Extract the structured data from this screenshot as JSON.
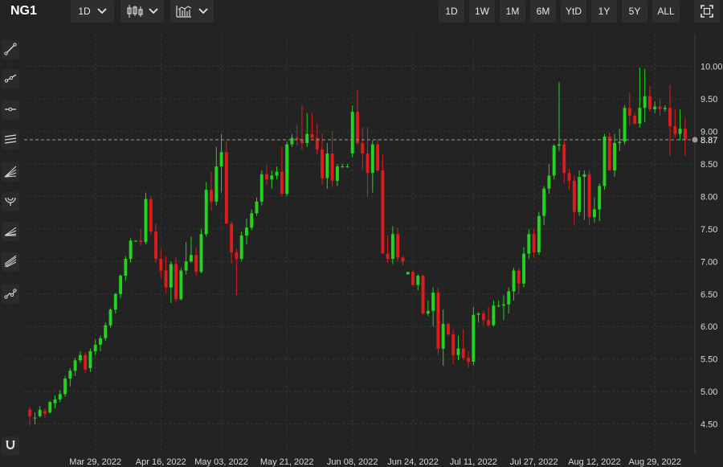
{
  "toolbar": {
    "symbol": "NG1",
    "interval": "1D",
    "chart_type_icon": "candlestick-icon",
    "indicator_icon": "indicators-icon",
    "ranges": [
      "1D",
      "1W",
      "1M",
      "6M",
      "YtD",
      "1Y",
      "5Y",
      "ALL"
    ],
    "fullscreen_icon": "fullscreen-icon"
  },
  "sidebar": {
    "tools": [
      "trendline-icon",
      "ray-icon",
      "horizontal-line-icon",
      "parallel-channel-icon",
      "fib-fan-icon",
      "arc-icon",
      "pitchfork-icon",
      "gann-icon",
      "path-icon"
    ],
    "bottom_tool": "magnet-icon"
  },
  "colors": {
    "up": "#22d41f",
    "down": "#e01b1b",
    "background": "#232323",
    "grid": "#363636",
    "axis_text": "#d8d8d8"
  },
  "chart_data": {
    "type": "candlestick",
    "ylim": [
      4.1,
      10.5
    ],
    "y_ticks": [
      "10.00",
      "9.50",
      "9.00",
      "8.50",
      "8.00",
      "7.50",
      "7.00",
      "6.50",
      "6.00",
      "5.50",
      "5.00",
      "4.50"
    ],
    "current_price": "8.87",
    "x_ticks": [
      "Mar 29, 2022",
      "Apr 16, 2022",
      "May 03, 2022",
      "May 21, 2022",
      "Jun 08, 2022",
      "Jun 24, 2022",
      "Jul 11, 2022",
      "Jul 27, 2022",
      "Aug 12, 2022",
      "Aug 29, 2022"
    ],
    "x_tick_index": [
      13,
      26,
      38,
      51,
      64,
      76,
      88,
      100,
      112,
      124
    ],
    "grid": true,
    "candles": [
      [
        4.72,
        4.76,
        4.48,
        4.62
      ],
      [
        4.6,
        4.68,
        4.5,
        4.6
      ],
      [
        4.62,
        4.78,
        4.6,
        4.72
      ],
      [
        4.7,
        4.74,
        4.6,
        4.66
      ],
      [
        4.68,
        4.86,
        4.66,
        4.84
      ],
      [
        4.82,
        4.94,
        4.74,
        4.88
      ],
      [
        4.88,
        5.02,
        4.84,
        4.96
      ],
      [
        4.96,
        5.24,
        4.92,
        5.2
      ],
      [
        5.2,
        5.36,
        5.08,
        5.32
      ],
      [
        5.32,
        5.52,
        5.24,
        5.48
      ],
      [
        5.48,
        5.62,
        5.44,
        5.56
      ],
      [
        5.56,
        5.6,
        5.28,
        5.34
      ],
      [
        5.36,
        5.66,
        5.3,
        5.62
      ],
      [
        5.62,
        5.8,
        5.56,
        5.72
      ],
      [
        5.72,
        5.86,
        5.62,
        5.82
      ],
      [
        5.82,
        6.06,
        5.78,
        6.02
      ],
      [
        6.02,
        6.28,
        5.98,
        6.26
      ],
      [
        6.26,
        6.52,
        6.2,
        6.5
      ],
      [
        6.5,
        6.8,
        6.44,
        6.78
      ],
      [
        6.78,
        7.08,
        6.7,
        7.04
      ],
      [
        7.04,
        7.36,
        6.98,
        7.32
      ],
      [
        7.32,
        7.32,
        7.3,
        7.32
      ],
      [
        7.32,
        7.5,
        7.24,
        7.3
      ],
      [
        7.3,
        8.06,
        7.26,
        7.96
      ],
      [
        7.96,
        8.0,
        7.4,
        7.46
      ],
      [
        7.46,
        7.58,
        6.98,
        7.04
      ],
      [
        7.04,
        7.2,
        6.74,
        6.86
      ],
      [
        6.86,
        7.08,
        6.52,
        6.6
      ],
      [
        6.6,
        7.0,
        6.36,
        6.96
      ],
      [
        6.96,
        7.06,
        6.38,
        6.42
      ],
      [
        6.42,
        6.9,
        6.4,
        6.86
      ],
      [
        6.86,
        7.3,
        6.8,
        7.0
      ],
      [
        7.0,
        7.38,
        6.98,
        7.1
      ],
      [
        7.1,
        7.22,
        6.78,
        6.84
      ],
      [
        6.84,
        7.5,
        6.82,
        7.42
      ],
      [
        7.42,
        8.22,
        7.38,
        8.1
      ],
      [
        8.1,
        8.38,
        7.78,
        7.92
      ],
      [
        7.92,
        8.76,
        7.86,
        8.46
      ],
      [
        8.46,
        8.96,
        8.06,
        8.68
      ],
      [
        8.68,
        8.84,
        7.62,
        7.58
      ],
      [
        7.58,
        7.62,
        6.96,
        7.14
      ],
      [
        7.14,
        7.2,
        6.48,
        7.04
      ],
      [
        7.04,
        7.46,
        7.0,
        7.4
      ],
      [
        7.4,
        7.66,
        7.26,
        7.52
      ],
      [
        7.52,
        7.8,
        7.48,
        7.74
      ],
      [
        7.74,
        7.98,
        7.7,
        7.92
      ],
      [
        7.92,
        8.4,
        7.86,
        8.34
      ],
      [
        8.34,
        8.48,
        8.18,
        8.26
      ],
      [
        8.26,
        8.4,
        8.12,
        8.32
      ],
      [
        8.32,
        8.46,
        8.26,
        8.38
      ],
      [
        8.38,
        8.76,
        8.0,
        8.04
      ],
      [
        8.04,
        8.84,
        8.0,
        8.8
      ],
      [
        8.8,
        8.96,
        8.76,
        8.9
      ],
      [
        8.9,
        9.1,
        8.78,
        8.88
      ],
      [
        8.88,
        9.4,
        8.72,
        8.82
      ],
      [
        8.82,
        9.28,
        8.76,
        8.96
      ],
      [
        8.96,
        9.28,
        8.86,
        8.9
      ],
      [
        8.9,
        9.12,
        8.64,
        8.72
      ],
      [
        8.72,
        8.96,
        8.18,
        8.28
      ],
      [
        8.28,
        8.82,
        8.12,
        8.66
      ],
      [
        8.66,
        9.0,
        8.14,
        8.24
      ],
      [
        8.24,
        8.5,
        8.16,
        8.46
      ],
      [
        8.46,
        8.5,
        8.44,
        8.46
      ],
      [
        8.46,
        8.5,
        8.44,
        8.46
      ],
      [
        8.66,
        9.4,
        8.6,
        9.3
      ],
      [
        9.3,
        9.64,
        8.8,
        8.82
      ],
      [
        8.82,
        9.06,
        8.4,
        8.66
      ],
      [
        8.66,
        9.06,
        8.0,
        8.36
      ],
      [
        8.36,
        8.86,
        8.06,
        8.8
      ],
      [
        8.8,
        8.88,
        8.38,
        8.4
      ],
      [
        8.4,
        8.64,
        7.6,
        7.12
      ],
      [
        7.12,
        7.4,
        6.98,
        7.04
      ],
      [
        7.04,
        7.54,
        6.96,
        7.42
      ],
      [
        7.42,
        7.52,
        7.0,
        7.06
      ],
      [
        7.06,
        7.08,
        6.94,
        7.0
      ],
      [
        6.8,
        6.84,
        6.8,
        6.84
      ],
      [
        6.84,
        6.86,
        6.62,
        6.64
      ],
      [
        6.64,
        6.8,
        6.56,
        6.78
      ],
      [
        6.78,
        6.8,
        6.18,
        6.2
      ],
      [
        6.2,
        6.4,
        6.16,
        6.24
      ],
      [
        6.24,
        6.6,
        6.0,
        6.52
      ],
      [
        6.52,
        6.6,
        5.56,
        5.66
      ],
      [
        5.66,
        6.26,
        5.4,
        6.04
      ],
      [
        6.04,
        6.06,
        5.86,
        5.88
      ],
      [
        5.88,
        5.96,
        5.42,
        5.56
      ],
      [
        5.56,
        5.86,
        5.48,
        5.66
      ],
      [
        5.66,
        5.96,
        5.48,
        5.52
      ],
      [
        5.52,
        5.62,
        5.36,
        5.46
      ],
      [
        5.46,
        6.3,
        5.4,
        6.18
      ],
      [
        6.18,
        6.22,
        6.06,
        6.2
      ],
      [
        6.2,
        6.24,
        6.02,
        6.1
      ],
      [
        6.1,
        6.3,
        6.0,
        6.02
      ],
      [
        6.02,
        6.4,
        6.0,
        6.32
      ],
      [
        6.32,
        6.4,
        6.3,
        6.32
      ],
      [
        6.32,
        6.48,
        6.1,
        6.34
      ],
      [
        6.34,
        6.6,
        6.2,
        6.54
      ],
      [
        6.54,
        6.9,
        6.4,
        6.86
      ],
      [
        6.86,
        6.9,
        6.5,
        6.66
      ],
      [
        6.66,
        7.22,
        6.6,
        7.12
      ],
      [
        7.12,
        7.5,
        7.04,
        7.42
      ],
      [
        7.42,
        7.5,
        7.06,
        7.14
      ],
      [
        7.14,
        7.76,
        7.1,
        7.7
      ],
      [
        7.7,
        8.16,
        7.56,
        8.12
      ],
      [
        8.12,
        8.5,
        8.04,
        8.32
      ],
      [
        8.32,
        8.8,
        8.26,
        8.78
      ],
      [
        8.78,
        9.76,
        8.7,
        8.8
      ],
      [
        8.8,
        8.88,
        8.2,
        8.36
      ],
      [
        8.36,
        8.42,
        8.1,
        8.24
      ],
      [
        8.24,
        8.32,
        7.56,
        7.76
      ],
      [
        7.76,
        8.4,
        7.7,
        8.3
      ],
      [
        8.3,
        8.4,
        7.64,
        8.34
      ],
      [
        8.34,
        8.4,
        7.56,
        7.68
      ],
      [
        7.68,
        7.98,
        7.6,
        7.8
      ],
      [
        7.8,
        8.2,
        7.62,
        8.16
      ],
      [
        8.16,
        8.96,
        8.1,
        8.92
      ],
      [
        8.92,
        8.98,
        8.4,
        8.4
      ],
      [
        8.4,
        8.96,
        8.3,
        8.82
      ],
      [
        8.82,
        9.04,
        8.7,
        8.84
      ],
      [
        8.84,
        9.4,
        8.8,
        9.36
      ],
      [
        9.36,
        9.6,
        9.1,
        9.24
      ],
      [
        9.24,
        9.28,
        9.1,
        9.12
      ],
      [
        9.12,
        9.98,
        9.06,
        9.36
      ],
      [
        9.36,
        9.96,
        9.14,
        9.54
      ],
      [
        9.54,
        9.7,
        9.3,
        9.34
      ],
      [
        9.34,
        9.46,
        9.28,
        9.38
      ],
      [
        9.38,
        9.5,
        9.24,
        9.34
      ],
      [
        9.34,
        9.4,
        9.3,
        9.36
      ],
      [
        9.36,
        9.72,
        8.62,
        9.08
      ],
      [
        9.08,
        9.34,
        8.9,
        8.96
      ],
      [
        8.96,
        9.34,
        8.86,
        9.04
      ],
      [
        9.04,
        9.2,
        8.62,
        8.87
      ]
    ]
  }
}
